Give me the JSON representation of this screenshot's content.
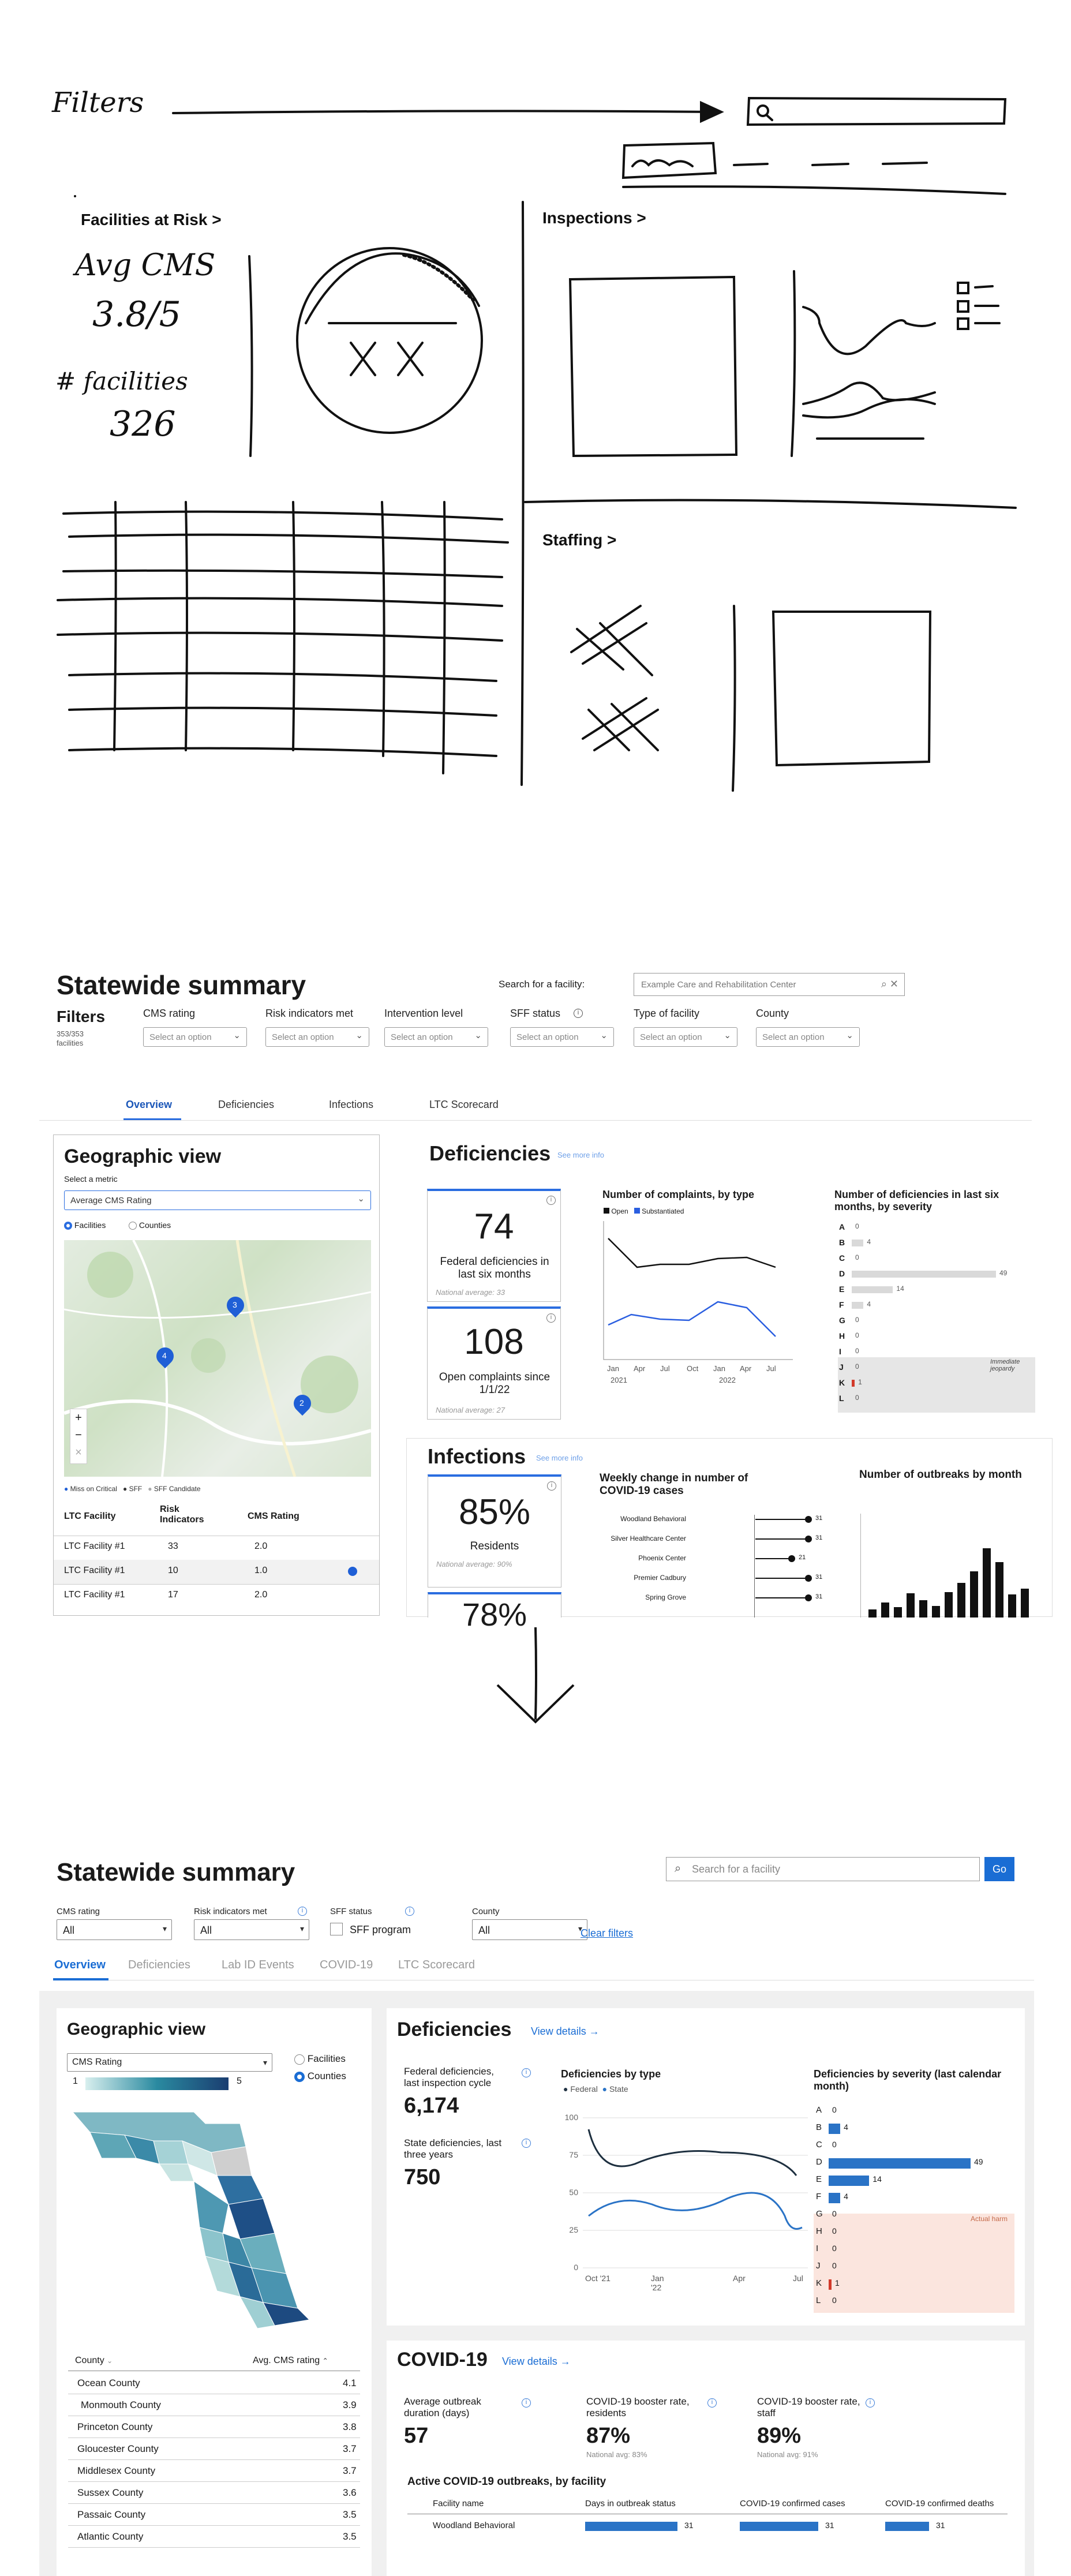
{
  "sketch": {
    "filters_label": "Filters",
    "facilities_at_risk": "Facilities at Risk >",
    "inspections": "Inspections >",
    "staffing": "Staffing >",
    "avg_cms_label": "Avg CMS",
    "avg_cms_value": "3.8/5",
    "facilities_label": "# facilities",
    "facilities_value": "326",
    "search_icon": "search-icon"
  },
  "wireframe": {
    "title": "Statewide summary",
    "filters_label": "Filters",
    "filters_count": "353/353",
    "filters_count_sub": "facilities",
    "search_label": "Search for a facility:",
    "search_value": "Example Care and Rehabilitation Center",
    "filters": [
      {
        "label": "CMS rating",
        "placeholder": "Select an option"
      },
      {
        "label": "Risk indicators met",
        "placeholder": "Select an option"
      },
      {
        "label": "Intervention level",
        "placeholder": "Select an option"
      },
      {
        "label": "SFF status",
        "placeholder": "Select an option"
      },
      {
        "label": "Type of facility",
        "placeholder": "Select an option"
      },
      {
        "label": "County",
        "placeholder": "Select an option"
      }
    ],
    "tabs": [
      "Overview",
      "Deficiencies",
      "Infections",
      "LTC Scorecard"
    ],
    "geo": {
      "title": "Geographic view",
      "metric_label": "Select a metric",
      "metric_value": "Average CMS Rating",
      "radio_facilities": "Facilities",
      "radio_counties": "Counties",
      "legend": [
        "Miss on Critical",
        "SFF",
        "SFF Candidate"
      ],
      "columns": [
        "LTC Facility",
        "Risk Indicators",
        "CMS Rating"
      ],
      "rows": [
        {
          "name": "LTC Facility #1",
          "risk": "33",
          "cms": "2.0"
        },
        {
          "name": "LTC Facility #1",
          "risk": "10",
          "cms": "1.0"
        },
        {
          "name": "LTC Facility #1",
          "risk": "17",
          "cms": "2.0"
        }
      ],
      "markers": [
        "3",
        "4",
        "2"
      ]
    },
    "deficiencies": {
      "title": "Deficiencies",
      "link": "See more info",
      "stat1_value": "74",
      "stat1_label": "Federal deficiencies in last six months",
      "stat1_note": "National average: 33",
      "stat2_value": "108",
      "stat2_label": "Open complaints since 1/1/22",
      "stat2_note": "National average: 27",
      "complaints_title": "Number of complaints, by type",
      "complaints_legend": [
        "Open",
        "Substantiated"
      ],
      "complaints_x": [
        "Jan",
        "Apr",
        "Jul",
        "Oct",
        "Jan",
        "Apr",
        "Jul"
      ],
      "complaints_years": [
        "2021",
        "2022"
      ],
      "severity_title": "Number of deficiencies in last six months, by severity",
      "severity_letters": [
        "A",
        "B",
        "C",
        "D",
        "E",
        "F",
        "G",
        "H",
        "I",
        "J",
        "K",
        "L"
      ],
      "severity_values": [
        0,
        4,
        0,
        49,
        14,
        4,
        0,
        0,
        0,
        0,
        1,
        0
      ],
      "severity_note": "Immediate jeopardy"
    },
    "infections": {
      "title": "Infections",
      "link": "See more info",
      "stat1_value": "85%",
      "stat1_label": "Residents",
      "stat1_note": "National average: 90%",
      "stat2_value": "78%",
      "weekly_title": "Weekly change in number of COVID-19 cases",
      "weekly_rows": [
        {
          "name": "Woodland Behavioral",
          "value": 31
        },
        {
          "name": "Silver Healthcare Center",
          "value": 31
        },
        {
          "name": "Phoenix Center",
          "value": 21
        },
        {
          "name": "Premier Cadbury",
          "value": 31
        },
        {
          "name": "Spring Grove",
          "value": 31
        }
      ],
      "outbreaks_title": "Number of outbreaks by month"
    }
  },
  "final": {
    "title": "Statewide summary",
    "search_placeholder": "Search for a facility",
    "go_label": "Go",
    "filters": [
      {
        "label": "CMS rating",
        "value": "All"
      },
      {
        "label": "Risk indicators met",
        "value": "All"
      },
      {
        "label": "SFF status",
        "value": "SFF program"
      },
      {
        "label": "County",
        "value": "All"
      }
    ],
    "clear_filters": "Clear filters",
    "tabs": [
      "Overview",
      "Deficiencies",
      "Lab ID Events",
      "COVID-19",
      "LTC Scorecard"
    ],
    "geo": {
      "title": "Geographic view",
      "metric_value": "CMS Rating",
      "scale_min": "1",
      "scale_max": "5",
      "radio_facilities": "Facilities",
      "radio_counties": "Counties",
      "col_county": "County",
      "col_avg": "Avg. CMS rating",
      "rows": [
        {
          "county": "Ocean County",
          "avg": "4.1"
        },
        {
          "county": "Monmouth County",
          "avg": "3.9"
        },
        {
          "county": "Princeton County",
          "avg": "3.8"
        },
        {
          "county": "Gloucester County",
          "avg": "3.7"
        },
        {
          "county": "Middlesex County",
          "avg": "3.7"
        },
        {
          "county": "Sussex County",
          "avg": "3.6"
        },
        {
          "county": "Passaic County",
          "avg": "3.5"
        },
        {
          "county": "Atlantic County",
          "avg": "3.5"
        }
      ]
    },
    "deficiencies": {
      "title": "Deficiencies",
      "link": "View details →",
      "stat1_label": "Federal deficiencies, last inspection cycle",
      "stat1_value": "6,174",
      "stat2_label": "State deficiencies, last three years",
      "stat2_value": "750",
      "by_type_title": "Deficiencies by type",
      "by_type_legend": [
        "Federal",
        "State"
      ],
      "by_type_yticks": [
        "100",
        "75",
        "50",
        "25",
        "0"
      ],
      "by_type_x": [
        "Oct '21",
        "Jan '22",
        "Apr",
        "Jul"
      ],
      "severity_title": "Deficiencies by severity (last calendar month)",
      "severity_letters": [
        "A",
        "B",
        "C",
        "D",
        "E",
        "F",
        "G",
        "H",
        "I",
        "J",
        "K",
        "L"
      ],
      "severity_values": [
        0,
        4,
        0,
        49,
        14,
        4,
        0,
        0,
        0,
        0,
        1,
        0
      ],
      "severity_note": "Actual harm"
    },
    "covid": {
      "title": "COVID-19",
      "link": "View details →",
      "stat1_label": "Average outbreak duration (days)",
      "stat1_value": "57",
      "stat2_label": "COVID-19 booster rate, residents",
      "stat2_value": "87%",
      "stat2_note": "National avg: 83%",
      "stat3_label": "COVID-19 booster rate, staff",
      "stat3_value": "89%",
      "stat3_note": "National avg: 91%",
      "outbreaks_title": "Active COVID-19 outbreaks, by facility",
      "columns": [
        "Facility name",
        "Days in outbreak status",
        "COVID-19 confirmed cases",
        "COVID-19 confirmed deaths"
      ],
      "rows": [
        {
          "name": "Woodland Behavioral",
          "days": "31",
          "cases": "31",
          "deaths": "31"
        }
      ]
    }
  },
  "chart_data": [
    {
      "type": "bar",
      "title": "Number of deficiencies in last six months, by severity",
      "categories": [
        "A",
        "B",
        "C",
        "D",
        "E",
        "F",
        "G",
        "H",
        "I",
        "J",
        "K",
        "L"
      ],
      "values": [
        0,
        4,
        0,
        49,
        14,
        4,
        0,
        0,
        0,
        0,
        1,
        0
      ]
    },
    {
      "type": "bar",
      "title": "Deficiencies by severity (last calendar month)",
      "categories": [
        "A",
        "B",
        "C",
        "D",
        "E",
        "F",
        "G",
        "H",
        "I",
        "J",
        "K",
        "L"
      ],
      "values": [
        0,
        4,
        0,
        49,
        14,
        4,
        0,
        0,
        0,
        0,
        1,
        0
      ]
    }
  ]
}
